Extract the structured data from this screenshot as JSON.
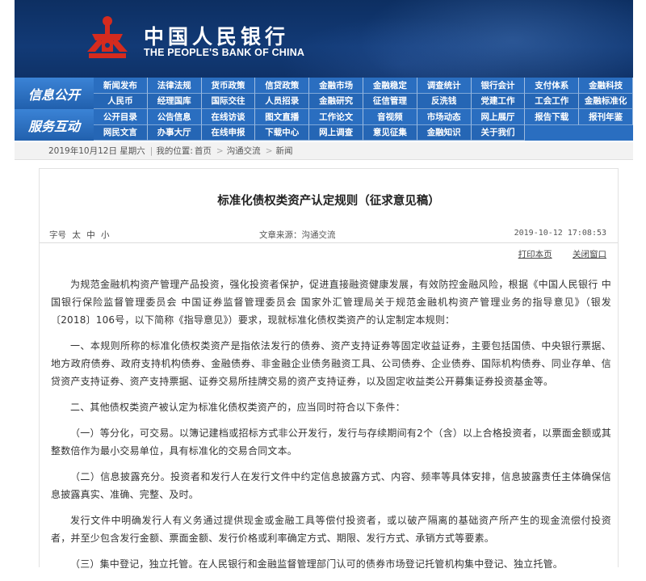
{
  "header": {
    "cn_name": "中国人民银行",
    "en_name": "THE PEOPLE'S BANK OF CHINA",
    "colors": {
      "banner": "#123a76",
      "nav": "#2a6ec0",
      "logo": "#d52b1e"
    }
  },
  "nav": {
    "category1": "信息公开",
    "category2": "服务互动",
    "rows": [
      [
        "新闻发布",
        "法律法规",
        "货币政策",
        "信贷政策",
        "金融市场",
        "金融稳定",
        "调查统计",
        "银行会计",
        "支付体系",
        "金融科技"
      ],
      [
        "人民币",
        "经理国库",
        "国际交往",
        "人员招录",
        "金融研究",
        "征信管理",
        "反洗钱",
        "党建工作",
        "工会工作",
        "金融标准化"
      ],
      [
        "公开目录",
        "公告信息",
        "在线访谈",
        "图文直播",
        "工作论文",
        "音视频",
        "市场动态",
        "网上展厅",
        "报告下载",
        "报刊年鉴"
      ],
      [
        "网民文言",
        "办事大厅",
        "在线申报",
        "下载中心",
        "网上调查",
        "意见征集",
        "金融知识",
        "关于我们"
      ]
    ]
  },
  "breadcrumb": {
    "date": "2019年10月12日 星期六",
    "location_label": "我的位置:",
    "items": [
      "首页",
      "沟通交流",
      "新闻"
    ]
  },
  "article": {
    "title": "标准化债权类资产认定规则（征求意见稿）",
    "font_size_label": "字号",
    "font_sizes": [
      "太",
      "中",
      "小"
    ],
    "source": "文章来源：沟通交流",
    "datetime": "2019-10-12  17:08:53",
    "print_label": "打印本页",
    "close_label": "关闭窗口",
    "paragraphs": [
      "为规范金融机构资产管理产品投资，强化投资者保护，促进直接融资健康发展，有效防控金融风险，根据《中国人民银行 中国银行保险监督管理委员会 中国证券监督管理委员会 国家外汇管理局关于规范金融机构资产管理业务的指导意见》（银发〔2018〕106号，以下简称《指导意见》）要求，现就标准化债权类资产的认定制定本规则：",
      "一、本规则所称的标准化债权类资产是指依法发行的债券、资产支持证券等固定收益证券，主要包括国债、中央银行票据、地方政府债券、政府支持机构债券、金融债券、非金融企业债务融资工具、公司债券、企业债券、国际机构债券、同业存单、信贷资产支持证券、资产支持票据、证券交易所挂牌交易的资产支持证券，以及固定收益类公开募集证券投资基金等。",
      "二、其他债权类资产被认定为标准化债权类资产的，应当同时符合以下条件：",
      "（一）等分化，可交易。以簿记建档或招标方式非公开发行，发行与存续期间有2个（含）以上合格投资者，以票面金额或其整数倍作为最小交易单位，具有标准化的交易合同文本。",
      "（二）信息披露充分。投资者和发行人在发行文件中约定信息披露方式、内容、频率等具体安排，信息披露责任主体确保信息披露真实、准确、完整、及时。",
      "发行文件中明确发行人有义务通过提供现金或金融工具等偿付投资者，或以破产隔离的基础资产所产生的现金流偿付投资者，并至少包含发行金额、票面金额、发行价格或利率确定方式、期限、发行方式、承销方式等要素。",
      "（三）集中登记，独立托管。在人民银行和金融监督管理部门认可的债券市场登记托管机构集中登记、独立托管。"
    ]
  }
}
